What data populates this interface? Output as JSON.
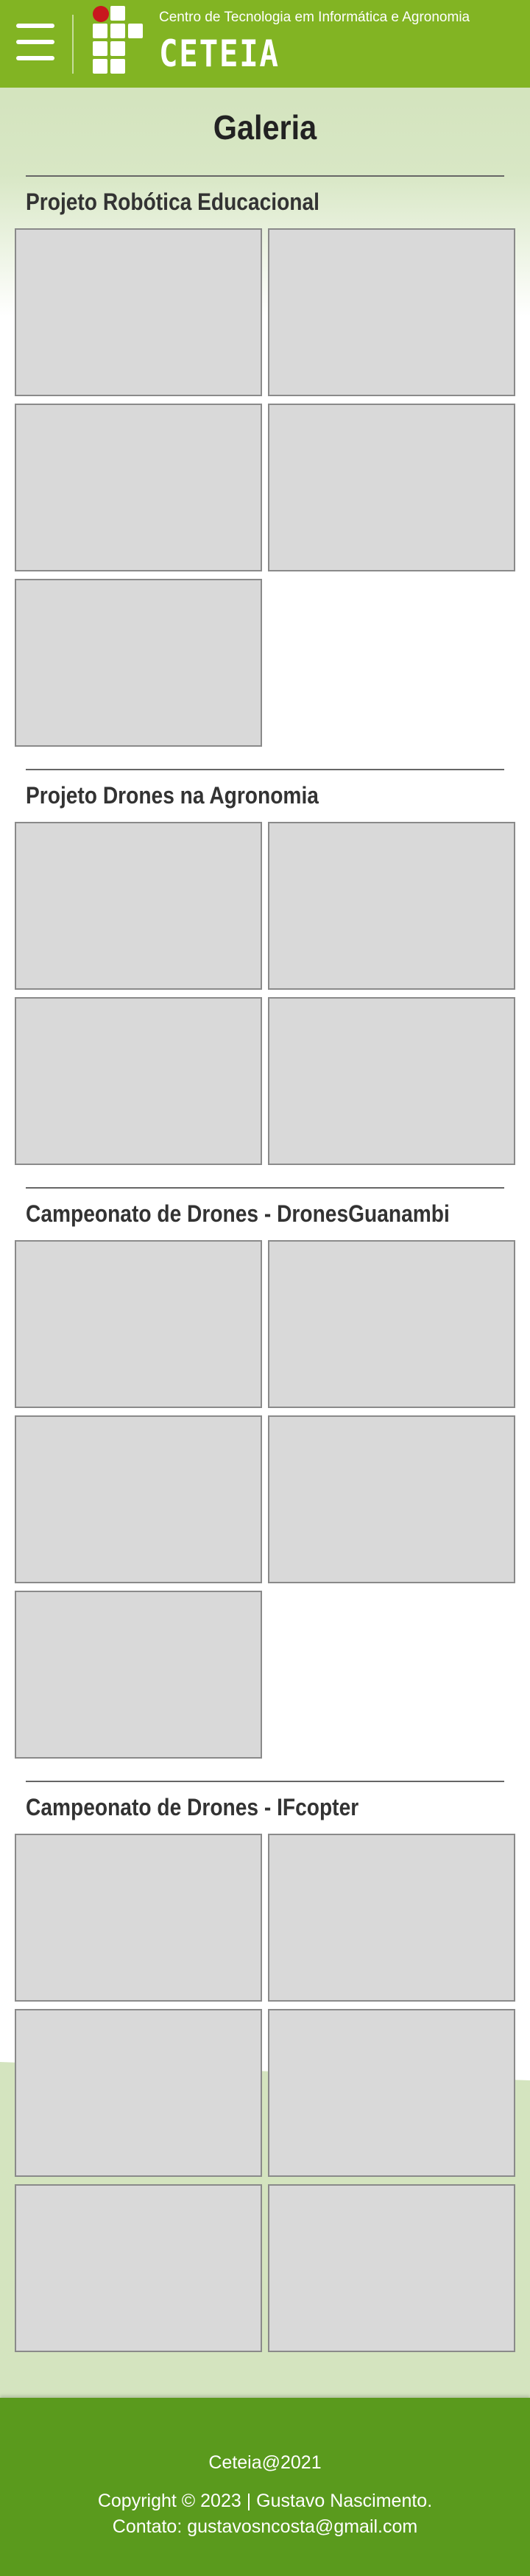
{
  "header": {
    "subtitle": "Centro de Tecnologia em Informática e Agronomia",
    "brand": "CETEIA",
    "menu_icon": "hamburger-menu-icon",
    "logo": "institution-logo",
    "colors": {
      "background": "#82b423",
      "logo_dot": "#c8171e",
      "text": "#ffffff"
    }
  },
  "main": {
    "title": "Galeria",
    "sections": [
      {
        "title": "Projeto Robótica Educacional",
        "images": 5
      },
      {
        "title": "Projeto Drones na Agronomia",
        "images": 4
      },
      {
        "title": "Campeonato de Drones - DronesGuanambi",
        "images": 5
      },
      {
        "title": "Campeonato de Drones - IFcopter",
        "images": 6
      }
    ]
  },
  "footer": {
    "brand_line": "Ceteia@2021",
    "copyright": "Copyright © 2023 | Gustavo Nascimento.",
    "contact": "Contato: gustavosncosta@gmail.com",
    "colors": {
      "background": "#5a9a1d",
      "text": "#ffffff"
    }
  }
}
